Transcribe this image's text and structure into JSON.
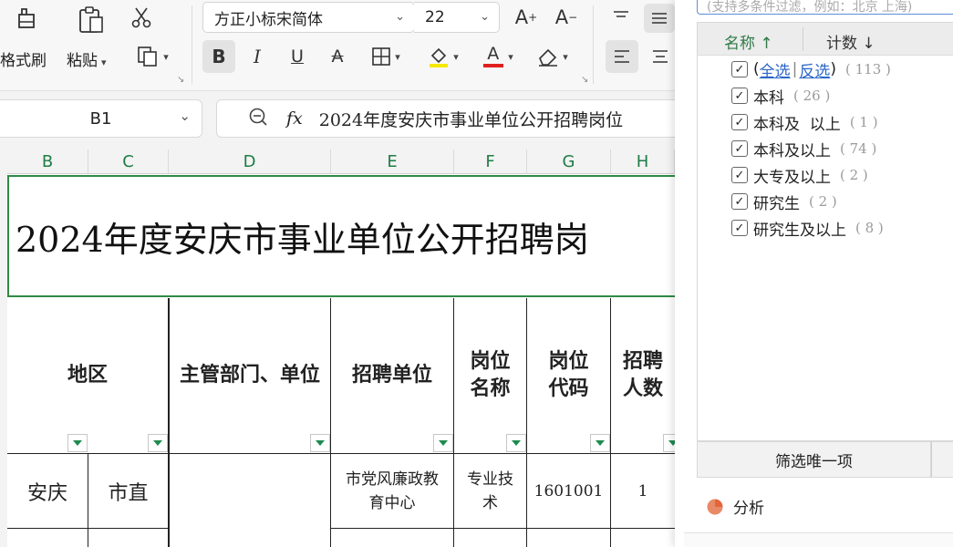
{
  "ribbon": {
    "format_painter_label": "格式刷",
    "paste_label": "粘贴",
    "font_name": "方正小标宋简体",
    "font_size": "22",
    "bold": "B",
    "italic": "I",
    "underline": "U",
    "strikethrough": "A",
    "font_color_letter": "A",
    "grow_font": "A",
    "shrink_font": "A",
    "colors": {
      "highlight": "#f5e800",
      "font": "#e02020",
      "accent": "#1e7d45"
    }
  },
  "formula_bar": {
    "name_box": "B1",
    "fx": "fx",
    "content": "2024年度安庆市事业单位公开招聘岗位"
  },
  "columns": [
    "B",
    "C",
    "D",
    "E",
    "F",
    "G",
    "H"
  ],
  "sheet": {
    "title": "2024年度安庆市事业单位公开招聘岗",
    "headers": {
      "region": "地区",
      "dept": "主管部门、单位",
      "unit": "招聘单位",
      "post_name_1": "岗位",
      "post_name_2": "名称",
      "post_code_1": "岗位",
      "post_code_2": "代码",
      "count_1": "招聘",
      "count_2": "人数"
    },
    "row1": {
      "region": "安庆",
      "city": "市直",
      "unit_1": "市党风廉政教",
      "unit_2": "育中心",
      "post_1": "专业技",
      "post_2": "术",
      "code": "1601001",
      "count": "1"
    }
  },
  "filter_panel": {
    "search_placeholder": "(支持多条件过滤，例如：北京 上海)",
    "col_name": "名称",
    "col_count": "计数",
    "select_all_open": "(",
    "select_all": "全选",
    "sep": "|",
    "invert": "反选",
    "select_all_close": ")",
    "items": [
      {
        "label": "本科",
        "count": "( 26 )"
      },
      {
        "label": "本科及  以上",
        "count": "( 1 )"
      },
      {
        "label": "本科及以上",
        "count": "( 74 )"
      },
      {
        "label": "大专及以上",
        "count": "( 2 )"
      },
      {
        "label": "研究生",
        "count": "( 2 )"
      },
      {
        "label": "研究生及以上",
        "count": "( 8 )"
      }
    ],
    "total_count": "( 113 )",
    "filter_unique_button": "筛选唯一项",
    "analysis_label": "分析"
  }
}
